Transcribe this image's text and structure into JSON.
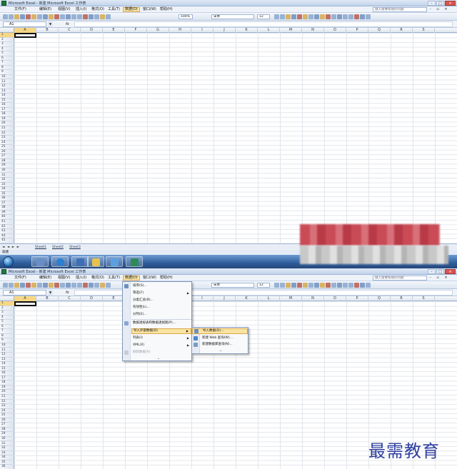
{
  "top_window": {
    "title": "Microsoft Excel - 新建 Microsoft Excel 工作表",
    "menu": [
      "文件(F)",
      "编辑(E)",
      "视图(V)",
      "插入(I)",
      "格式(O)",
      "工具(T)",
      "数据(D)",
      "窗口(W)",
      "帮助(H)"
    ],
    "active_menu": "数据(D)",
    "help_placeholder": "键入需要帮助的问题",
    "zoom": "100%",
    "font_name": "宋体",
    "font_size": "12",
    "name_box": "A1",
    "fx": "fx",
    "columns": [
      "A",
      "B",
      "C",
      "D",
      "E",
      "F",
      "G",
      "H",
      "I",
      "J",
      "K",
      "L",
      "M",
      "N",
      "O",
      "P",
      "Q",
      "R",
      "S"
    ],
    "rows": [
      "1",
      "2",
      "3",
      "4",
      "5",
      "6",
      "7",
      "8",
      "9",
      "10",
      "11",
      "12",
      "13",
      "14",
      "15",
      "16",
      "17",
      "18",
      "19",
      "20",
      "21",
      "22",
      "23",
      "24",
      "25",
      "26",
      "27",
      "28",
      "29",
      "30",
      "31",
      "32",
      "33",
      "34",
      "35",
      "36",
      "37",
      "38",
      "39",
      "40",
      "41",
      "42",
      "43",
      "44",
      "45"
    ],
    "sheet_nav": "◄ ◄ ► ►",
    "sheet_tabs": [
      "Sheet1",
      "Sheet2",
      "Sheet3"
    ],
    "status": "就绪"
  },
  "bottom_window": {
    "title": "Microsoft Excel - 新建 Microsoft Excel 工作表",
    "menu": [
      "文件(F)",
      "编辑(E)",
      "视图(V)",
      "插入(I)",
      "格式(O)",
      "工具(T)",
      "数据(D)",
      "窗口(W)",
      "帮助(H)"
    ],
    "help_placeholder": "键入需要帮助的问题",
    "font_name": "宋体",
    "font_size": "12",
    "name_box": "A1",
    "fx": "fx",
    "columns": [
      "A",
      "B",
      "C",
      "D",
      "E",
      "F",
      "G",
      "H",
      "I",
      "J",
      "K",
      "L",
      "M",
      "N",
      "O",
      "P",
      "Q",
      "R",
      "S"
    ],
    "rows": [
      "1",
      "2",
      "3",
      "4",
      "5",
      "6",
      "7",
      "8",
      "9",
      "10",
      "11",
      "12",
      "13",
      "14",
      "15",
      "16",
      "17",
      "18",
      "19",
      "20",
      "21",
      "22",
      "23",
      "24",
      "25",
      "26",
      "27",
      "28",
      "29",
      "30",
      "31",
      "32",
      "33",
      "34",
      "35",
      "36",
      "37",
      "38",
      "39",
      "40"
    ],
    "data_menu": {
      "items": [
        {
          "label": "排序(S)...",
          "submenu": false
        },
        {
          "label": "筛选(F)",
          "submenu": true
        },
        {
          "label": "分类汇总(B)...",
          "submenu": false
        },
        {
          "label": "有效性(L)...",
          "submenu": false
        },
        {
          "label": "分列(E)...",
          "submenu": false
        },
        {
          "label": "数据透视表和数据透视图(P)...",
          "submenu": false
        },
        {
          "label": "导入外部数据(D)",
          "submenu": true,
          "highlight": true
        },
        {
          "label": "列表(I)",
          "submenu": true
        },
        {
          "label": "XML(X)",
          "submenu": true
        },
        {
          "label": "刷新数据(R)",
          "submenu": false,
          "disabled": true
        }
      ],
      "more": "⌄"
    },
    "import_submenu": {
      "items": [
        {
          "label": "导入数据(D)...",
          "highlight": true
        },
        {
          "label": "新建 Web 查询(W)..."
        },
        {
          "label": "新建数据库查询(N)..."
        }
      ],
      "more": "⌄"
    }
  },
  "watermark": "最需教育"
}
